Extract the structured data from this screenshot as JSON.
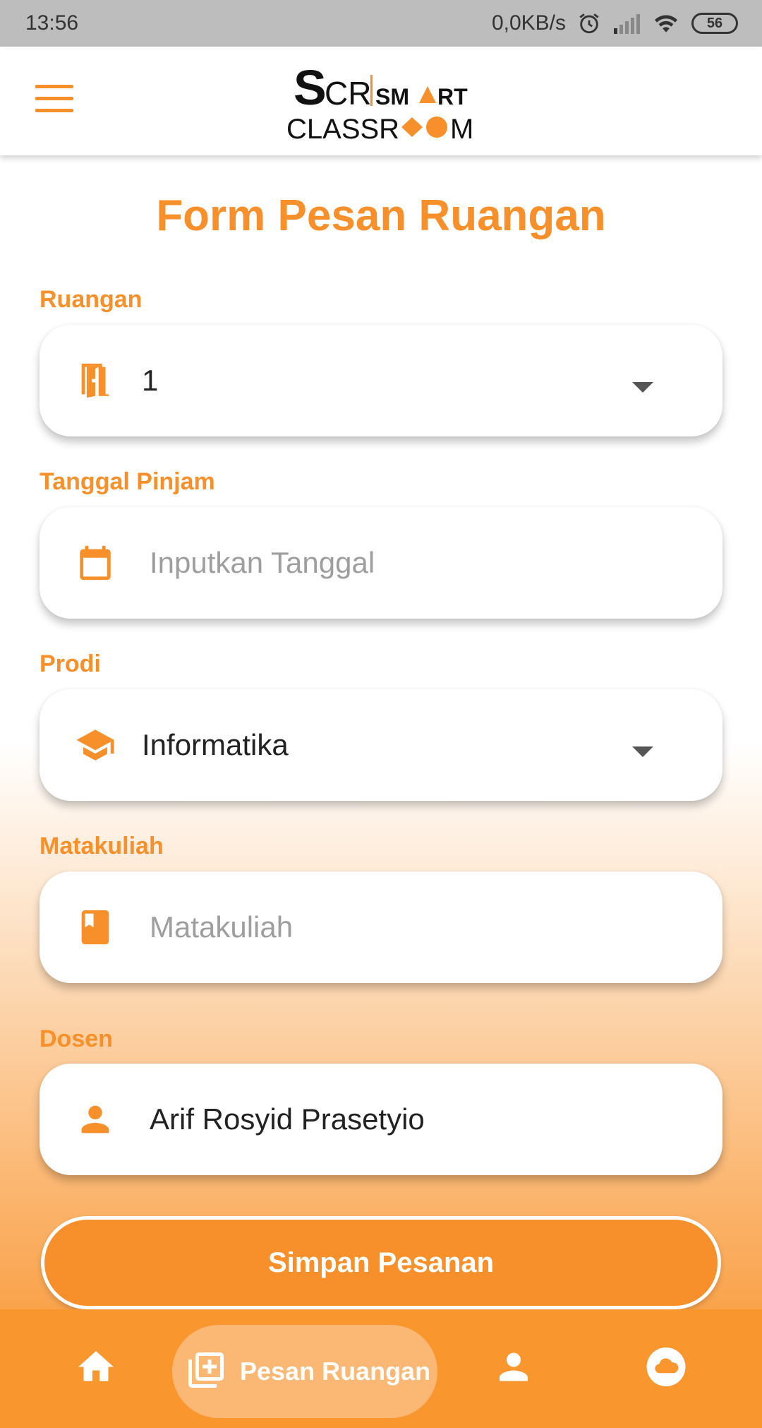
{
  "status_bar": {
    "time": "13:56",
    "network_speed": "0,0KB/s",
    "battery_level": "56",
    "icons": [
      "alarm-icon",
      "signal-icon",
      "wifi-icon",
      "battery-icon"
    ]
  },
  "app_bar": {
    "logo_text": "SCR SMART CLASSROOM",
    "menu_icon": "menu-icon"
  },
  "form": {
    "title": "Form Pesan Ruangan",
    "ruangan": {
      "label": "Ruangan",
      "value": "1",
      "icon": "door-icon"
    },
    "tanggal": {
      "label": "Tanggal Pinjam",
      "placeholder": "Inputkan Tanggal",
      "icon": "calendar-icon"
    },
    "prodi": {
      "label": "Prodi",
      "value": "Informatika",
      "icon": "school-icon"
    },
    "matakuliah": {
      "label": "Matakuliah",
      "placeholder": "Matakuliah",
      "icon": "book-icon"
    },
    "dosen": {
      "label": "Dosen",
      "value": "Arif Rosyid Prasetyio",
      "icon": "person-icon"
    },
    "submit_label": "Simpan Pesanan"
  },
  "bottom_nav": {
    "items": [
      {
        "icon": "home-icon",
        "label": ""
      },
      {
        "icon": "add-library-icon",
        "label": "Pesan Ruangan",
        "active": true
      },
      {
        "icon": "person-icon",
        "label": ""
      },
      {
        "icon": "cloud-icon",
        "label": ""
      }
    ]
  },
  "colors": {
    "accent": "#f7902a",
    "nav_background": "#f9962d",
    "nav_active_pill": "#fbb774",
    "placeholder": "#9e9e9e"
  }
}
